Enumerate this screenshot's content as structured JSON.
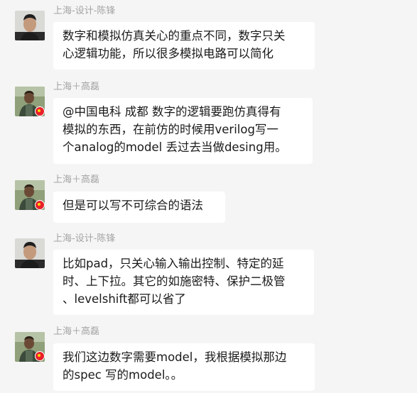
{
  "chat": {
    "messages": [
      {
        "sender": "上海-设计-陈锋",
        "avatar": "man-portrait-avatar",
        "text": "数字和模拟仿真关心的重点不同，数字只关\n心逻辑功能，所以很多模拟电路可以简化"
      },
      {
        "sender": "上海＋高磊",
        "avatar": "man-outdoor-avatar",
        "badge": "china-flag-icon",
        "text": "@中国电科 成都 数字的逻辑要跑仿真得有\n模拟的东西，在前仿的时候用verilog写一\n个analog的model 丢过去当做desing用。"
      },
      {
        "sender": "上海＋高磊",
        "avatar": "man-outdoor-avatar",
        "badge": "china-flag-icon",
        "text": "但是可以写不可综合的语法"
      },
      {
        "sender": "上海-设计-陈锋",
        "avatar": "man-portrait-avatar",
        "text": "比如pad，只关心输入输出控制、特定的延\n时、上下拉。其它的如施密特、保护二极管\n、levelshift都可以省了"
      },
      {
        "sender": "上海＋高磊",
        "avatar": "man-outdoor-avatar",
        "badge": "china-flag-icon",
        "text": "我们这边数字需要model，我根据模拟那边\n的spec  写的model。。"
      }
    ]
  },
  "colors": {
    "background": "#f5f5f5",
    "bubble": "#ffffff",
    "sender_name": "#a3a3a3",
    "message_text": "#1a1a1a",
    "flag_red": "#e8202a",
    "flag_star": "#ffd700"
  }
}
